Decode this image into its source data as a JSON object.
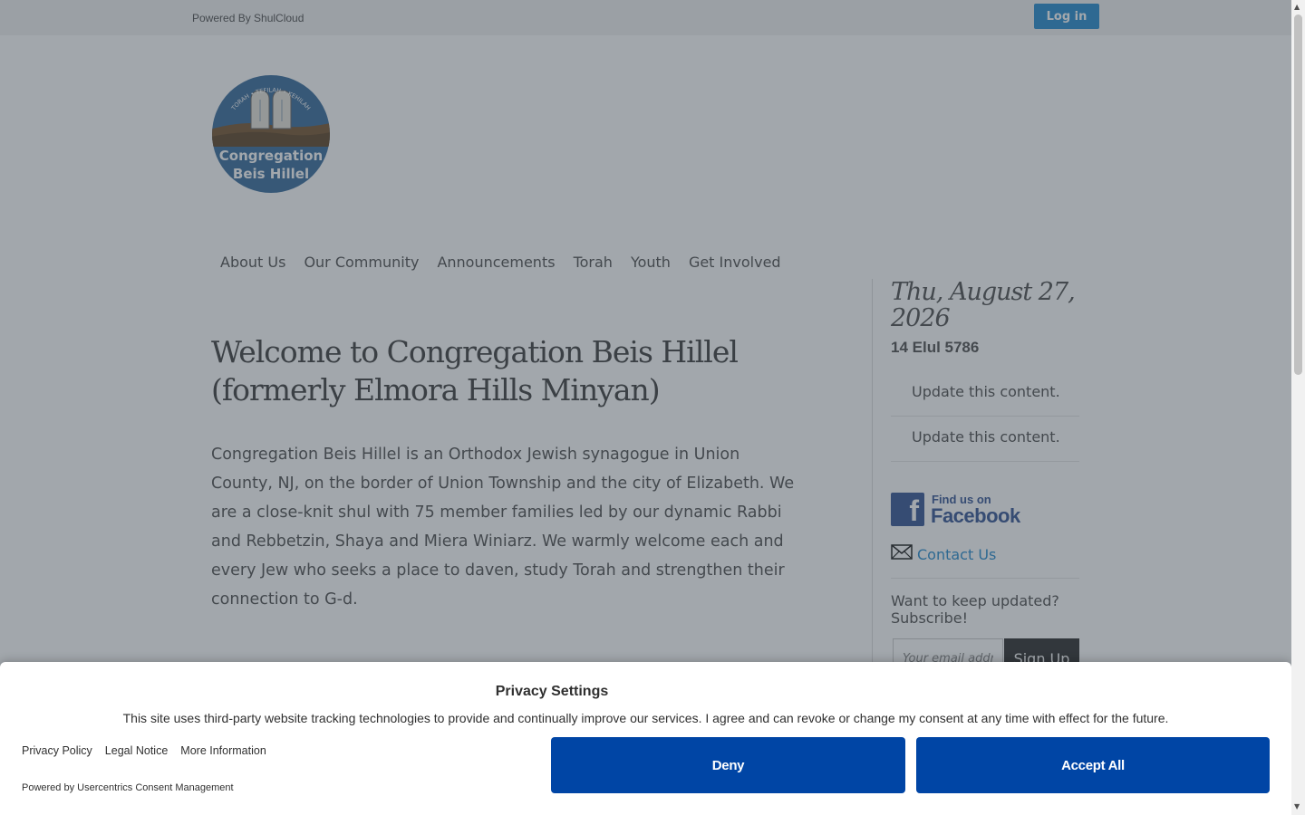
{
  "topbar": {
    "powered_by": "Powered By ShulCloud",
    "login_label": "Log in"
  },
  "logo": {
    "arc_text": "TORAH • TEFILAH • KEHILAH",
    "line1": "Congregation",
    "line2": "Beis Hillel"
  },
  "nav": {
    "items": [
      {
        "label": "About Us"
      },
      {
        "label": "Our Community"
      },
      {
        "label": "Announcements"
      },
      {
        "label": "Torah"
      },
      {
        "label": "Youth"
      },
      {
        "label": "Get Involved"
      }
    ]
  },
  "main": {
    "heading": "Welcome to Congregation Beis Hillel (formerly Elmora Hills Minyan)",
    "intro": "Congregation Beis Hillel is an Orthodox Jewish synagogue in Union County, NJ, on the border of Union Township and the city of Elizabeth. We are a close-knit shul with 75 member families led by our dynamic Rabbi and Rebbetzin, Shaya and Miera Winiarz. We warmly welcome each and every Jew who seeks a place to daven, study Torah and strengthen their connection to G-d."
  },
  "sidebar": {
    "date": "Thu, August 27, 2026",
    "hebrew_date": "14 Elul 5786",
    "update_items": [
      {
        "label": "Update this content."
      },
      {
        "label": "Update this content."
      }
    ],
    "facebook": {
      "small": "Find us on",
      "big": "Facebook",
      "letter": "f",
      "icon": "facebook-icon"
    },
    "contact_label": "Contact Us",
    "contact_icon": "envelope-icon",
    "subscribe_text": "Want to keep updated? Subscribe!",
    "email_placeholder": "Your email address",
    "signup_label": "Sign Up"
  },
  "consent": {
    "title": "Privacy Settings",
    "text": "This site uses third-party website tracking technologies to provide and continually improve our services. I agree and can revoke or change my consent at any time with effect for the future.",
    "links": [
      {
        "label": "Privacy Policy"
      },
      {
        "label": "Legal Notice"
      },
      {
        "label": "More Information"
      }
    ],
    "powered_by": "Powered by Usercentrics Consent Management",
    "deny_label": "Deny",
    "accept_label": "Accept All"
  },
  "scrollbar": {
    "up_icon": "scroll-up-arrow-icon",
    "down_icon": "scroll-down-arrow-icon"
  },
  "colors": {
    "accent_blue": "#2d8fcf",
    "consent_button": "#0045a5",
    "facebook_blue": "#3b5998",
    "logo_blue": "#3d6f9e",
    "logo_brown": "#7a5a36",
    "overlay": "rgba(48, 60, 72, 0.45)"
  }
}
